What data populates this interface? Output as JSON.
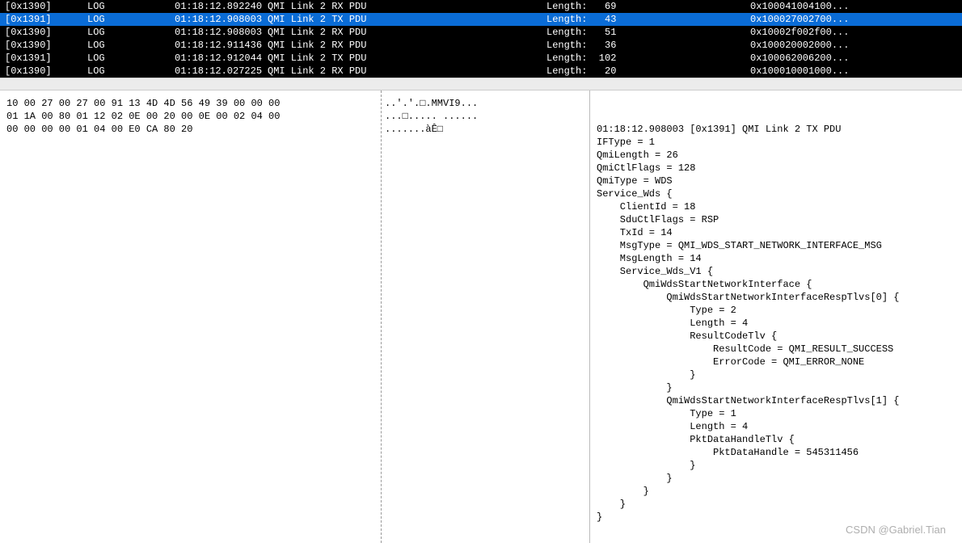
{
  "logs": [
    {
      "id": "[0x1390]",
      "level": "LOG",
      "time": "01:18:12.892240",
      "desc": "QMI Link 2 RX PDU",
      "len_label": "Length:",
      "len": "69",
      "hex": "0x100041004100...",
      "selected": false
    },
    {
      "id": "[0x1391]",
      "level": "LOG",
      "time": "01:18:12.908003",
      "desc": "QMI Link 2 TX PDU",
      "len_label": "Length:",
      "len": "43",
      "hex": "0x100027002700...",
      "selected": true
    },
    {
      "id": "[0x1390]",
      "level": "LOG",
      "time": "01:18:12.908003",
      "desc": "QMI Link 2 RX PDU",
      "len_label": "Length:",
      "len": "51",
      "hex": "0x10002f002f00...",
      "selected": false
    },
    {
      "id": "[0x1390]",
      "level": "LOG",
      "time": "01:18:12.911436",
      "desc": "QMI Link 2 RX PDU",
      "len_label": "Length:",
      "len": "36",
      "hex": "0x100020002000...",
      "selected": false
    },
    {
      "id": "[0x1391]",
      "level": "LOG",
      "time": "01:18:12.912044",
      "desc": "QMI Link 2 TX PDU",
      "len_label": "Length:",
      "len": "102",
      "hex": "0x100062006200...",
      "selected": false
    },
    {
      "id": "[0x1390]",
      "level": "LOG",
      "time": "01:18:12.027225",
      "desc": "QMI Link 2 RX PDU",
      "len_label": "Length:",
      "len": "20",
      "hex": "0x100010001000...",
      "selected": false
    }
  ],
  "hex_lines": [
    "10 00 27 00 27 00 91 13 4D 4D 56 49 39 00 00 00",
    "01 1A 00 80 01 12 02 0E 00 20 00 0E 00 02 04 00",
    "00 00 00 00 01 04 00 E0 CA 80 20"
  ],
  "ascii_lines": [
    "..'.'.□.MMVI9...",
    "...□..... ......",
    ".......àÊ□"
  ],
  "detail": "01:18:12.908003 [0x1391] QMI Link 2 TX PDU\nIFType = 1\nQmiLength = 26\nQmiCtlFlags = 128\nQmiType = WDS\nService_Wds {\n    ClientId = 18\n    SduCtlFlags = RSP\n    TxId = 14\n    MsgType = QMI_WDS_START_NETWORK_INTERFACE_MSG\n    MsgLength = 14\n    Service_Wds_V1 {\n        QmiWdsStartNetworkInterface {\n            QmiWdsStartNetworkInterfaceRespTlvs[0] {\n                Type = 2\n                Length = 4\n                ResultCodeTlv {\n                    ResultCode = QMI_RESULT_SUCCESS\n                    ErrorCode = QMI_ERROR_NONE\n                }\n            }\n            QmiWdsStartNetworkInterfaceRespTlvs[1] {\n                Type = 1\n                Length = 4\n                PktDataHandleTlv {\n                    PktDataHandle = 545311456\n                }\n            }\n        }\n    }\n}",
  "watermark": "CSDN @Gabriel.Tian"
}
